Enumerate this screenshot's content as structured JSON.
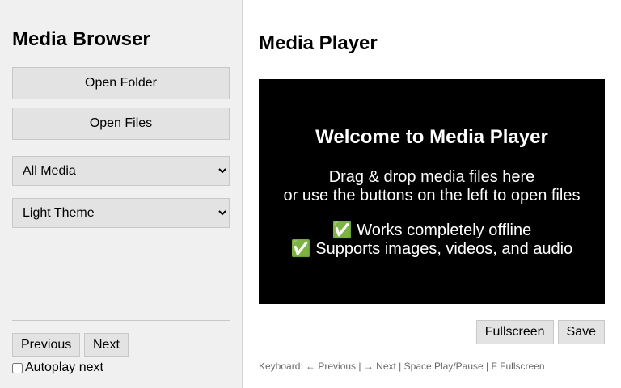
{
  "sidebar": {
    "title": "Media Browser",
    "open_folder": "Open Folder",
    "open_files": "Open Files",
    "filter": {
      "selected": "All Media"
    },
    "theme": {
      "selected": "Light Theme"
    },
    "previous": "Previous",
    "next": "Next",
    "autoplay_label": "Autoplay next"
  },
  "main": {
    "title": "Media Player",
    "welcome_title": "Welcome to Media Player",
    "hint_line1": "Drag & drop media files here",
    "hint_line2": "or use the buttons on the left to open files",
    "feature1": "Works completely offline",
    "feature2": "Supports images, videos, and audio",
    "fullscreen": "Fullscreen",
    "save": "Save",
    "shortcuts": "Keyboard: ← Previous | → Next | Space Play/Pause | F Fullscreen"
  },
  "icons": {
    "feature_check": "check-icon"
  }
}
